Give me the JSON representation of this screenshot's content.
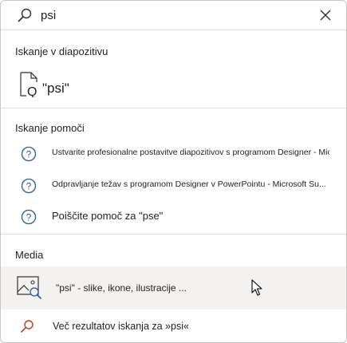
{
  "search": {
    "value": "psi",
    "search_icon": "search-icon",
    "close_icon": "close-icon"
  },
  "sections": {
    "slide_search": {
      "header": "Iskanje v diapozitivu",
      "result_label": "\"psi\"",
      "icon": "document-search-icon"
    },
    "help_search": {
      "header": "Iskanje pomoči",
      "items": [
        {
          "label": "Ustvarite profesionalne postavitve diapozitivov s programom Designer - Micro",
          "icon": "help-icon"
        },
        {
          "label": "Odpravljanje težav s programom Designer v PowerPointu - Microsoft Su...",
          "icon": "help-icon"
        },
        {
          "label": "Poiščite pomoč za \"pse\"",
          "icon": "help-icon"
        }
      ]
    },
    "media": {
      "header": "Media",
      "item_label": "\"psi\" - slike, ikone, ilustracije ...",
      "icon": "image-search-icon"
    }
  },
  "more_results": {
    "label": "Več rezultatov iskanja za »psi«",
    "icon": "search-icon"
  },
  "colors": {
    "help_icon": "#2b579a",
    "more_icon": "#c43e1c",
    "hover_bg": "#f3f2f1",
    "divider": "#e1dfdd"
  }
}
